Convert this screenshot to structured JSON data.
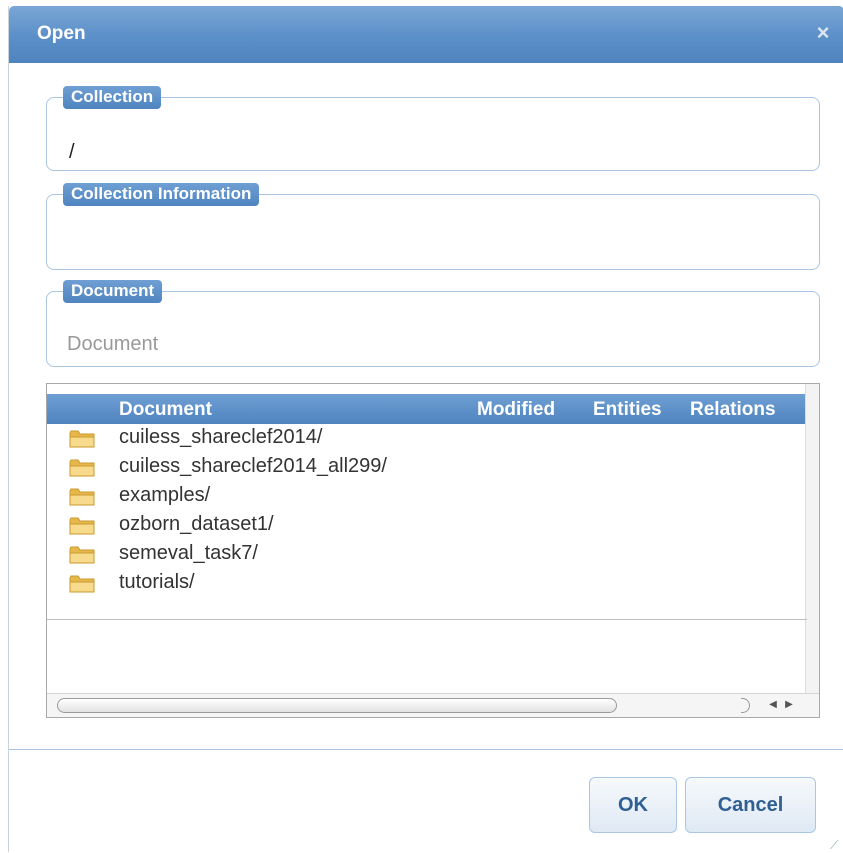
{
  "dialog": {
    "title": "Open",
    "close_label": "×"
  },
  "collection": {
    "legend": "Collection",
    "value": "/"
  },
  "collection_info": {
    "legend": "Collection Information",
    "value": ""
  },
  "document": {
    "legend": "Document",
    "placeholder": "Document",
    "value": ""
  },
  "file_list": {
    "columns": [
      "Document",
      "Modified",
      "Entities",
      "Relations"
    ],
    "rows": [
      {
        "icon": "folder-icon",
        "label": "cuiless_shareclef2014/"
      },
      {
        "icon": "folder-icon",
        "label": "cuiless_shareclef2014_all299/"
      },
      {
        "icon": "folder-icon",
        "label": "examples/"
      },
      {
        "icon": "folder-icon",
        "label": "ozborn_dataset1/"
      },
      {
        "icon": "folder-icon",
        "label": "semeval_task7/"
      },
      {
        "icon": "folder-icon",
        "label": "tutorials/"
      }
    ]
  },
  "buttons": {
    "ok": "OK",
    "cancel": "Cancel"
  },
  "colors": {
    "header_blue": "#4f84bf",
    "border_blue": "#a9c6e4",
    "button_text": "#2f5f94",
    "folder_yellow": "#f4d27a"
  }
}
